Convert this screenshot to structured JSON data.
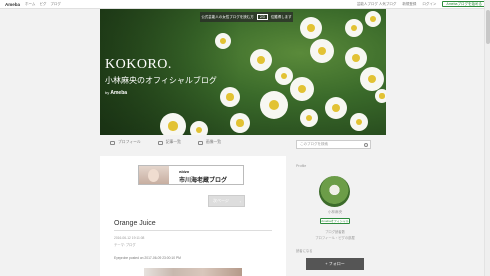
{
  "ameba_bar": {
    "logo": "Ameba",
    "nav": [
      "ホーム",
      "ピグ",
      "ブログ"
    ],
    "right_links": [
      "芸能人ブログ 人気ブログ",
      "新規登録",
      "ログイン"
    ],
    "register_button": "Amebaブログを始める"
  },
  "header": {
    "notice": "公式芸能人の女性ブログを読む方",
    "notice_num": "2/3",
    "notice_suffix": "位獲得します",
    "title": "KOKORO.",
    "subtitle": "小林麻央のオフィシャルブログ",
    "by_prefix": "by",
    "by_brand": "Ameba"
  },
  "tabs": [
    "プロフィール",
    "記事一覧",
    "画像一覧"
  ],
  "search": {
    "placeholder": "このブログを検索"
  },
  "banner": {
    "line1": "ebizo",
    "line2": "市川海老蔵ブログ"
  },
  "next_button": "次ページ",
  "post": {
    "title": "Orange Juice",
    "date": "2016-06-12 19:11:08",
    "theme": "テーマ: ブログ",
    "posted": "Eyeprobe posted on 2017-06-09 23:00:10 PM"
  },
  "sidebar": {
    "heading": "Profile",
    "name": "小林麻央",
    "badge": "Amebaオフィシャル",
    "info1": "ブログ読者数",
    "info2": "プロフィール・ピグの部屋",
    "heading2": "読者になる",
    "follow": "+ フォロー"
  },
  "colors": {
    "ameba_green": "#2d8c3c",
    "follow_bg": "#555555"
  }
}
